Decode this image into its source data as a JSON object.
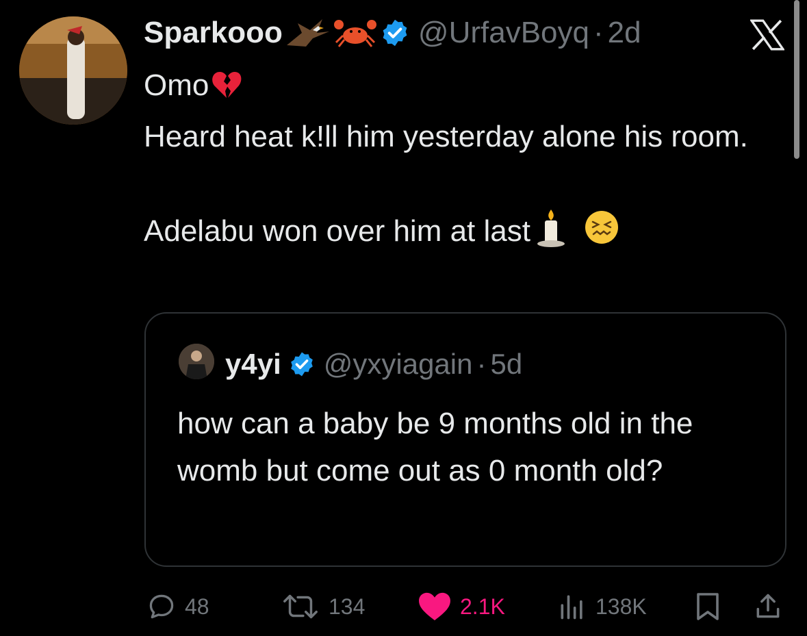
{
  "tweet": {
    "author_name": "Sparkooo",
    "name_emojis": [
      "eagle",
      "crab"
    ],
    "handle": "@UrfavBoyq",
    "separator": "·",
    "time": "2d",
    "lines": [
      "Omo",
      "Heard heat k!ll him yesterday alone his room.",
      "",
      "Adelabu won over him at last"
    ]
  },
  "quote": {
    "author_name": "y4yi",
    "handle": "@yxyiagain",
    "separator": "·",
    "time": "5d",
    "text": "how can a baby be 9 months old in the womb but come out as 0 month old?"
  },
  "actions": {
    "replies": "48",
    "reposts": "134",
    "likes": "2.1K",
    "views": "138K"
  },
  "icons": {
    "verified": "verified-badge-icon",
    "x_logo": "x-logo-icon",
    "reply": "reply-icon",
    "repost": "repost-icon",
    "like": "heart-icon",
    "views": "views-icon",
    "bookmark": "bookmark-icon",
    "share": "share-icon"
  },
  "colors": {
    "background": "#000000",
    "text": "#e7e9ea",
    "secondary": "#71767b",
    "verified": "#1d9bf0",
    "like": "#f91880",
    "border": "#2f3336"
  }
}
